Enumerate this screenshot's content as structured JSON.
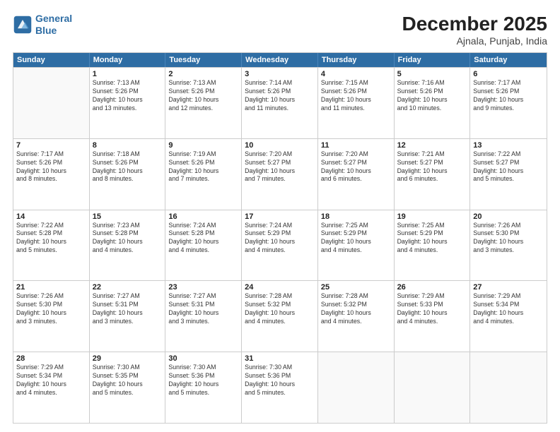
{
  "header": {
    "logo_line1": "General",
    "logo_line2": "Blue",
    "month": "December 2025",
    "location": "Ajnala, Punjab, India"
  },
  "days": [
    "Sunday",
    "Monday",
    "Tuesday",
    "Wednesday",
    "Thursday",
    "Friday",
    "Saturday"
  ],
  "rows": [
    [
      {
        "day": "",
        "info": ""
      },
      {
        "day": "1",
        "info": "Sunrise: 7:13 AM\nSunset: 5:26 PM\nDaylight: 10 hours\nand 13 minutes."
      },
      {
        "day": "2",
        "info": "Sunrise: 7:13 AM\nSunset: 5:26 PM\nDaylight: 10 hours\nand 12 minutes."
      },
      {
        "day": "3",
        "info": "Sunrise: 7:14 AM\nSunset: 5:26 PM\nDaylight: 10 hours\nand 11 minutes."
      },
      {
        "day": "4",
        "info": "Sunrise: 7:15 AM\nSunset: 5:26 PM\nDaylight: 10 hours\nand 11 minutes."
      },
      {
        "day": "5",
        "info": "Sunrise: 7:16 AM\nSunset: 5:26 PM\nDaylight: 10 hours\nand 10 minutes."
      },
      {
        "day": "6",
        "info": "Sunrise: 7:17 AM\nSunset: 5:26 PM\nDaylight: 10 hours\nand 9 minutes."
      }
    ],
    [
      {
        "day": "7",
        "info": "Sunrise: 7:17 AM\nSunset: 5:26 PM\nDaylight: 10 hours\nand 8 minutes."
      },
      {
        "day": "8",
        "info": "Sunrise: 7:18 AM\nSunset: 5:26 PM\nDaylight: 10 hours\nand 8 minutes."
      },
      {
        "day": "9",
        "info": "Sunrise: 7:19 AM\nSunset: 5:26 PM\nDaylight: 10 hours\nand 7 minutes."
      },
      {
        "day": "10",
        "info": "Sunrise: 7:20 AM\nSunset: 5:27 PM\nDaylight: 10 hours\nand 7 minutes."
      },
      {
        "day": "11",
        "info": "Sunrise: 7:20 AM\nSunset: 5:27 PM\nDaylight: 10 hours\nand 6 minutes."
      },
      {
        "day": "12",
        "info": "Sunrise: 7:21 AM\nSunset: 5:27 PM\nDaylight: 10 hours\nand 6 minutes."
      },
      {
        "day": "13",
        "info": "Sunrise: 7:22 AM\nSunset: 5:27 PM\nDaylight: 10 hours\nand 5 minutes."
      }
    ],
    [
      {
        "day": "14",
        "info": "Sunrise: 7:22 AM\nSunset: 5:28 PM\nDaylight: 10 hours\nand 5 minutes."
      },
      {
        "day": "15",
        "info": "Sunrise: 7:23 AM\nSunset: 5:28 PM\nDaylight: 10 hours\nand 4 minutes."
      },
      {
        "day": "16",
        "info": "Sunrise: 7:24 AM\nSunset: 5:28 PM\nDaylight: 10 hours\nand 4 minutes."
      },
      {
        "day": "17",
        "info": "Sunrise: 7:24 AM\nSunset: 5:29 PM\nDaylight: 10 hours\nand 4 minutes."
      },
      {
        "day": "18",
        "info": "Sunrise: 7:25 AM\nSunset: 5:29 PM\nDaylight: 10 hours\nand 4 minutes."
      },
      {
        "day": "19",
        "info": "Sunrise: 7:25 AM\nSunset: 5:29 PM\nDaylight: 10 hours\nand 4 minutes."
      },
      {
        "day": "20",
        "info": "Sunrise: 7:26 AM\nSunset: 5:30 PM\nDaylight: 10 hours\nand 3 minutes."
      }
    ],
    [
      {
        "day": "21",
        "info": "Sunrise: 7:26 AM\nSunset: 5:30 PM\nDaylight: 10 hours\nand 3 minutes."
      },
      {
        "day": "22",
        "info": "Sunrise: 7:27 AM\nSunset: 5:31 PM\nDaylight: 10 hours\nand 3 minutes."
      },
      {
        "day": "23",
        "info": "Sunrise: 7:27 AM\nSunset: 5:31 PM\nDaylight: 10 hours\nand 3 minutes."
      },
      {
        "day": "24",
        "info": "Sunrise: 7:28 AM\nSunset: 5:32 PM\nDaylight: 10 hours\nand 4 minutes."
      },
      {
        "day": "25",
        "info": "Sunrise: 7:28 AM\nSunset: 5:32 PM\nDaylight: 10 hours\nand 4 minutes."
      },
      {
        "day": "26",
        "info": "Sunrise: 7:29 AM\nSunset: 5:33 PM\nDaylight: 10 hours\nand 4 minutes."
      },
      {
        "day": "27",
        "info": "Sunrise: 7:29 AM\nSunset: 5:34 PM\nDaylight: 10 hours\nand 4 minutes."
      }
    ],
    [
      {
        "day": "28",
        "info": "Sunrise: 7:29 AM\nSunset: 5:34 PM\nDaylight: 10 hours\nand 4 minutes."
      },
      {
        "day": "29",
        "info": "Sunrise: 7:30 AM\nSunset: 5:35 PM\nDaylight: 10 hours\nand 5 minutes."
      },
      {
        "day": "30",
        "info": "Sunrise: 7:30 AM\nSunset: 5:36 PM\nDaylight: 10 hours\nand 5 minutes."
      },
      {
        "day": "31",
        "info": "Sunrise: 7:30 AM\nSunset: 5:36 PM\nDaylight: 10 hours\nand 5 minutes."
      },
      {
        "day": "",
        "info": ""
      },
      {
        "day": "",
        "info": ""
      },
      {
        "day": "",
        "info": ""
      }
    ]
  ]
}
